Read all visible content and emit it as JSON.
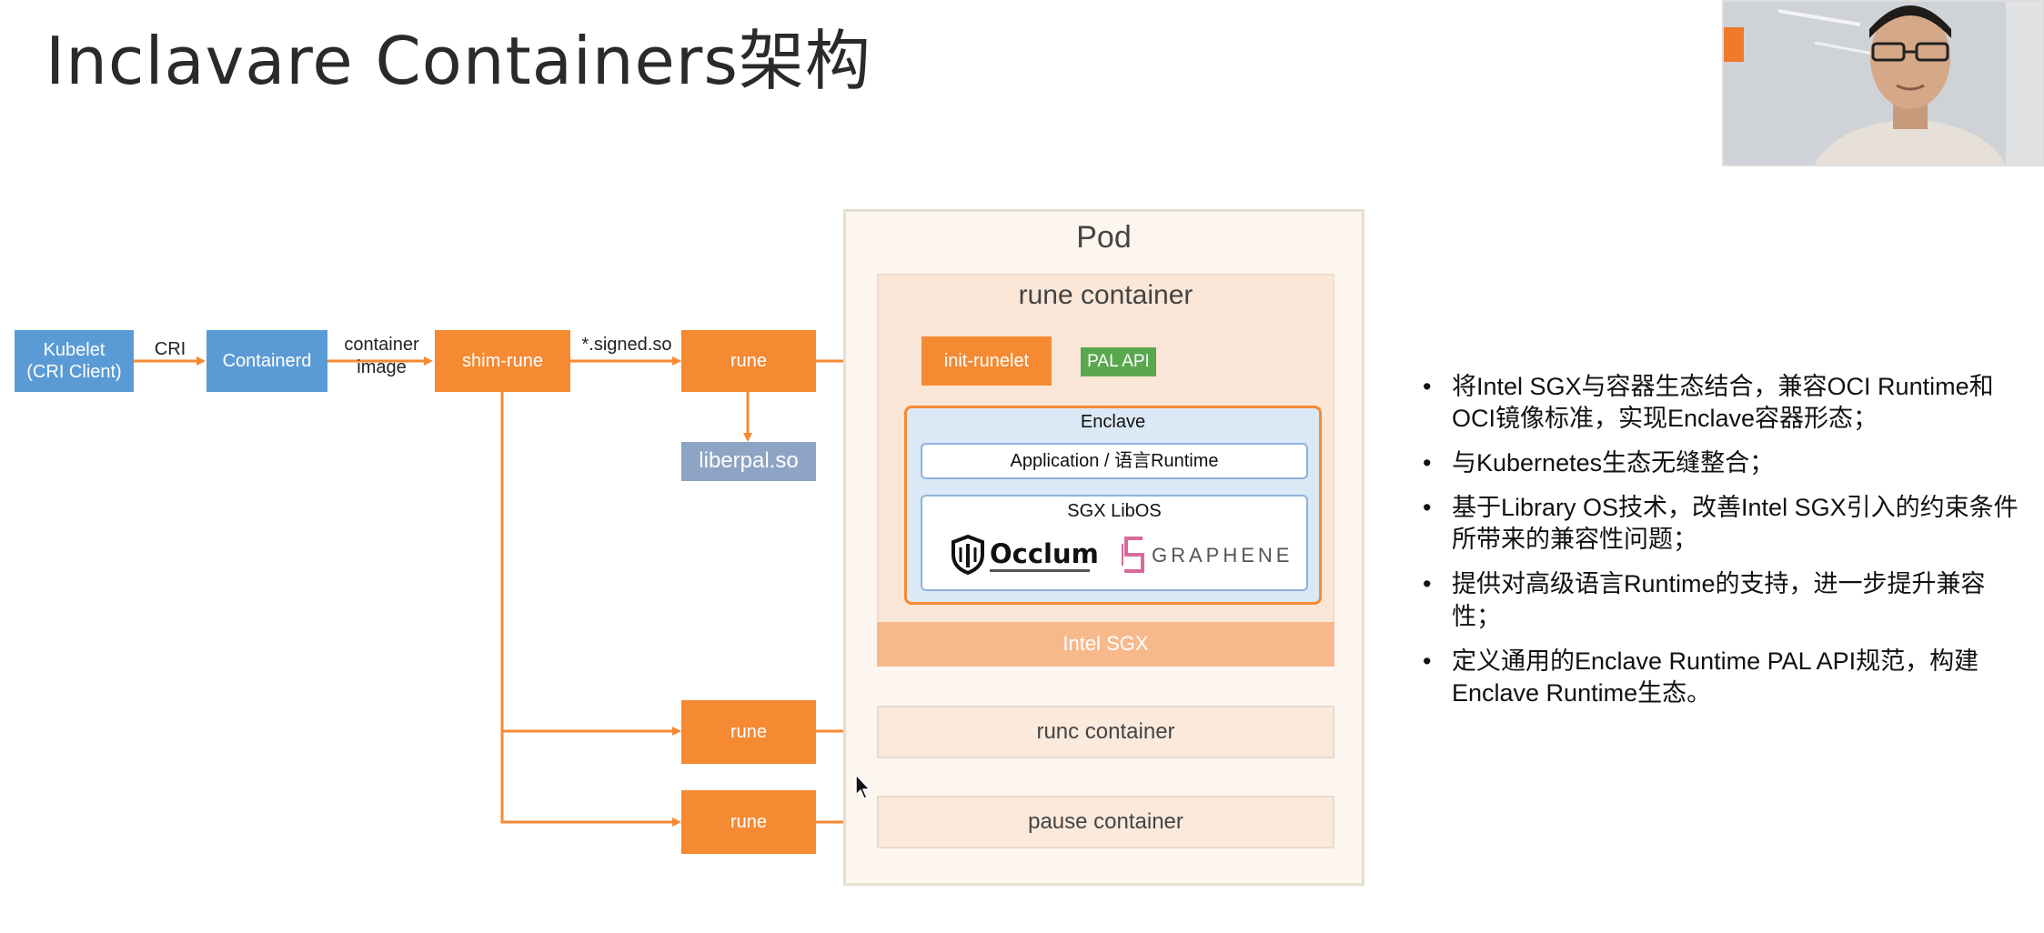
{
  "title": "Inclavare Containers架构",
  "diagram": {
    "kubelet": "Kubelet\n(CRI Client)",
    "cri_label": "CRI",
    "containerd": "Containerd",
    "container_image_label": "container\nimage",
    "shim_rune": "shim-rune",
    "signed_so_label": "*.signed.so",
    "rune_main": "rune",
    "liberpal": "liberpal.so",
    "pod_title": "Pod",
    "rune_container_title": "rune container",
    "init_runelet": "init-runelet",
    "pal_api": "PAL API",
    "enclave_title": "Enclave",
    "application_runtime": "Application / 语言Runtime",
    "sgx_libos": "SGX LibOS",
    "occlum_logo": "Occlum",
    "graphene_logo": "GRAPHENE",
    "intel_sgx": "Intel SGX",
    "rune_runc": "rune",
    "runc_container": "runc container",
    "rune_pause": "rune",
    "pause_container": "pause container"
  },
  "bullets": [
    "将Intel SGX与容器生态结合，兼容OCI Runtime和OCI镜像标准，实现Enclave容器形态；",
    "与Kubernetes生态无缝整合；",
    "基于Library OS技术，改善Intel SGX引入的约束条件所带来的兼容性问题；",
    "提供对高级语言Runtime的支持，进一步提升兼容性；",
    "定义通用的Enclave Runtime PAL API规范，构建Enclave Runtime生态。"
  ],
  "bullet_marker": "•",
  "colors": {
    "blue": "#5b9bd5",
    "orange": "#f58a33",
    "gray_blue": "#8ea4c4",
    "green": "#5aa84e",
    "pod_bg": "#fdf6ef",
    "rune_container_bg": "#fbe7d8",
    "enclave_bg": "#dbe8f6",
    "intel_sgx_bg": "#f7b98c"
  },
  "icons": [
    "arrow-icon",
    "occlum-shield-icon",
    "graphene-logo-icon",
    "mouse-cursor-icon"
  ]
}
